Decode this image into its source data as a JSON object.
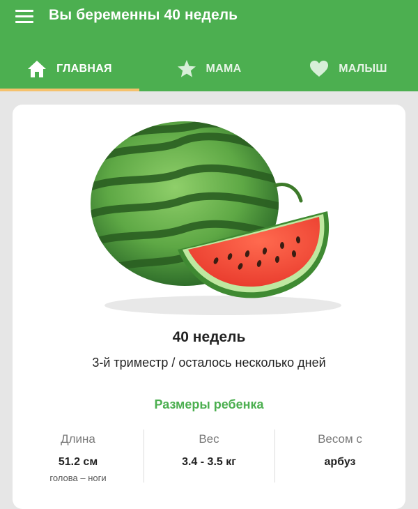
{
  "app": {
    "title": "Вы беременны 40 недель"
  },
  "tabs": [
    {
      "label": "ГЛАВНАЯ",
      "icon": "home-icon",
      "active": true
    },
    {
      "label": "МАМА",
      "icon": "star-icon",
      "active": false
    },
    {
      "label": "МАЛЫШ",
      "icon": "heart-icon",
      "active": false
    }
  ],
  "colors": {
    "primary": "#4caf50",
    "tab_indicator": "#f5c16c",
    "accent_text": "#4caf50"
  },
  "main": {
    "image": "watermelon-illustration",
    "week_title": "40 недель",
    "trimester_text": "3-й триместр / осталось несколько дней",
    "sizes_heading": "Размеры ребенка",
    "stats": [
      {
        "label": "Длина",
        "value": "51.2 см",
        "sub": "голова – ноги"
      },
      {
        "label": "Вес",
        "value": "3.4 - 3.5 кг"
      },
      {
        "label": "Весом с",
        "value": "арбуз"
      }
    ]
  }
}
